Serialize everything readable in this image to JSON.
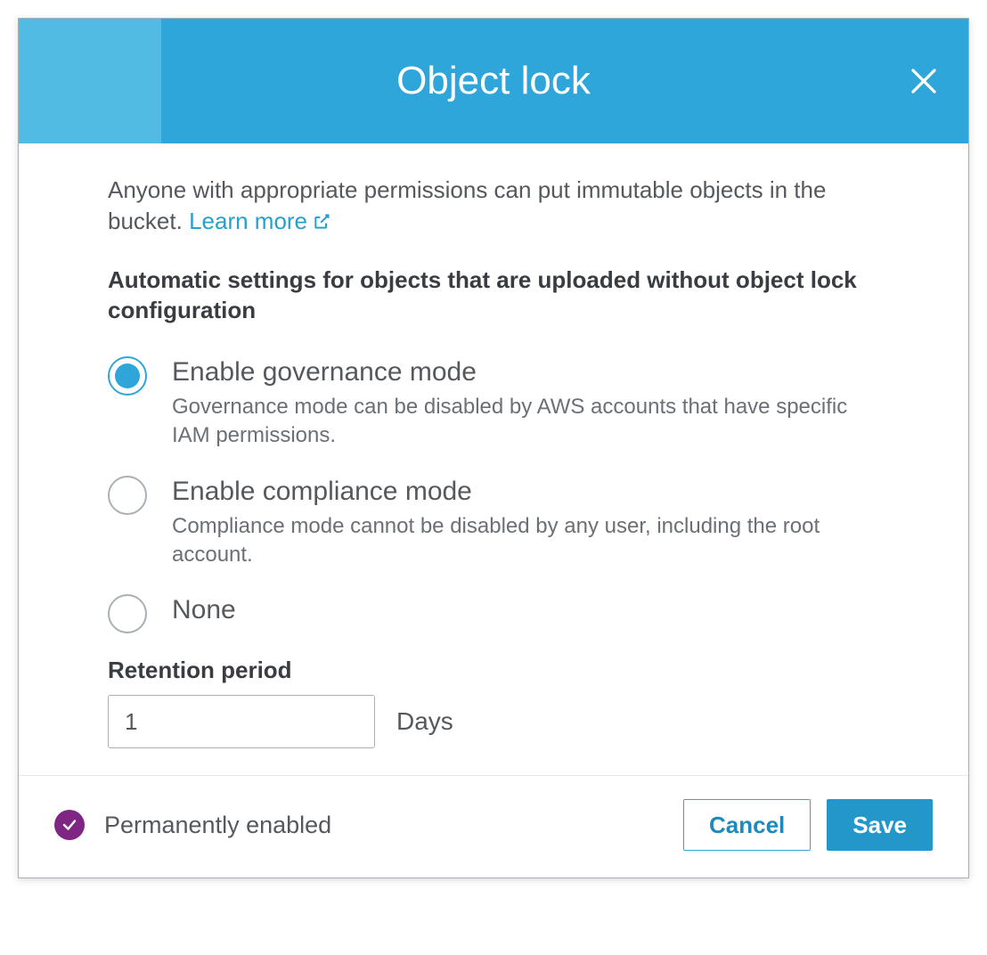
{
  "dialog": {
    "title": "Object lock",
    "description": "Anyone with appropriate permissions can put immutable objects in the bucket.",
    "learn_more": "Learn more",
    "section_heading": "Automatic settings for objects that are uploaded without object lock configuration",
    "options": [
      {
        "label": "Enable governance mode",
        "description": "Governance mode can be disabled by AWS accounts that have specific IAM permissions.",
        "selected": true
      },
      {
        "label": "Enable compliance mode",
        "description": "Compliance mode cannot be disabled by any user, including the root account.",
        "selected": false
      },
      {
        "label": "None",
        "description": "",
        "selected": false
      }
    ],
    "retention": {
      "label": "Retention period",
      "value": "1",
      "unit": "Days"
    },
    "footer": {
      "status": "Permanently enabled",
      "cancel": "Cancel",
      "save": "Save"
    }
  }
}
